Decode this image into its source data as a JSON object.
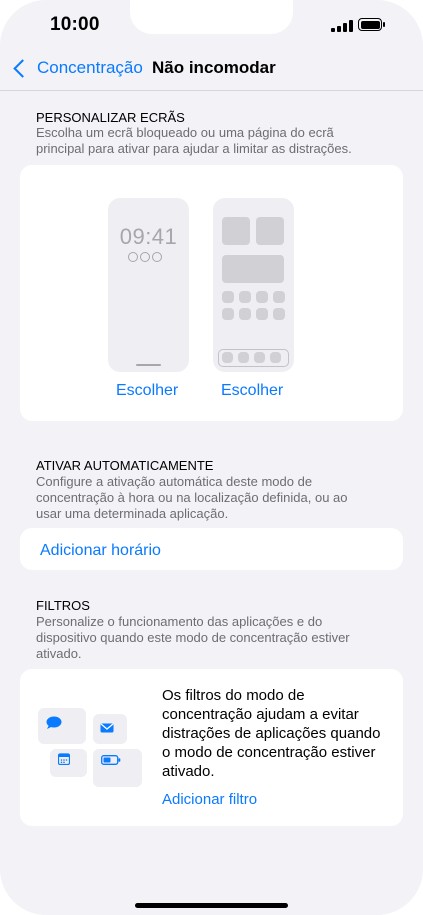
{
  "status_bar": {
    "time": "10:00"
  },
  "nav": {
    "back_label": "Concentração",
    "title": "Não incomodar"
  },
  "customize_screens": {
    "header": "PERSONALIZAR ECRÃS",
    "description": "Escolha um ecrã bloqueado ou uma página do ecrã principal para ativar para ajudar a limitar as distrações.",
    "lock_preview_time": "09:41",
    "choose_lock_label": "Escolher",
    "choose_home_label": "Escolher"
  },
  "auto_enable": {
    "header": "ATIVAR AUTOMATICAMENTE",
    "description": "Configure a ativação automática deste modo de concentração à hora ou na localização definida, ou ao usar uma determinada aplicação.",
    "add_schedule_label": "Adicionar horário"
  },
  "filters": {
    "header": "FILTROS",
    "description": "Personalize o funcionamento das aplicações e do dispositivo quando este modo de concentração estiver ativado.",
    "info_text": "Os filtros do modo de concentração ajudam a evitar distrações de aplicações quando o modo de concentração estiver ativado.",
    "add_filter_label": "Adicionar filtro"
  },
  "colors": {
    "accent": "#0a7aff",
    "background": "#f2f2f7",
    "card": "#ffffff",
    "secondary_text": "#6d6d72"
  }
}
